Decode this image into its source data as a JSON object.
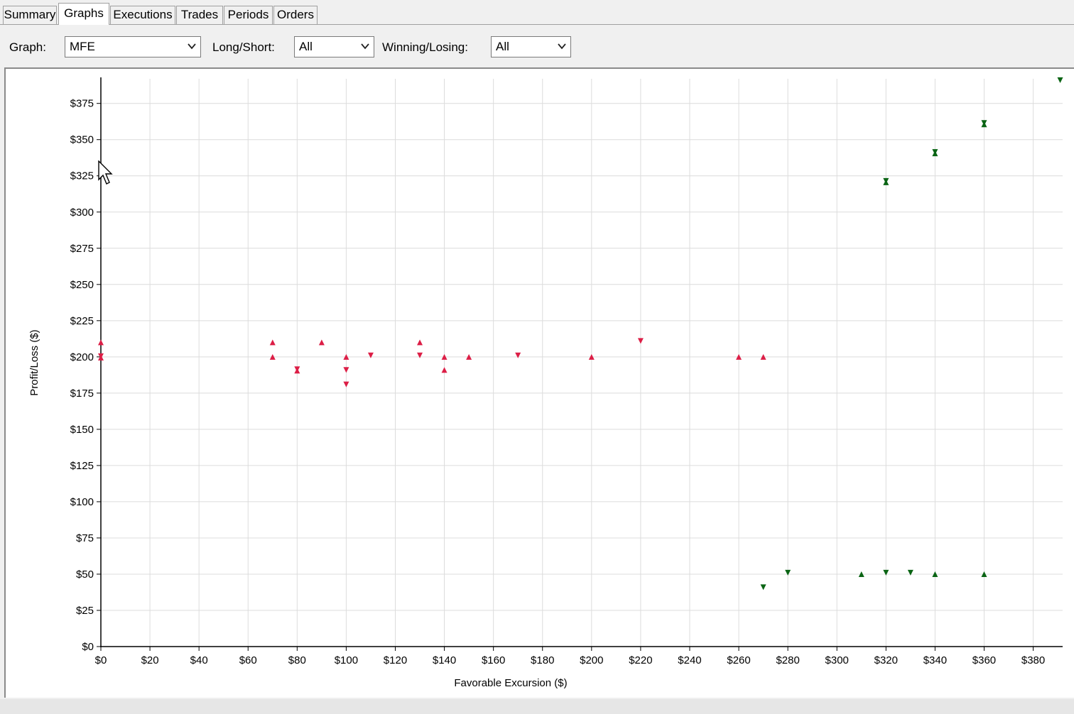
{
  "tabs": [
    {
      "label": "Summary",
      "active": false
    },
    {
      "label": "Graphs",
      "active": true
    },
    {
      "label": "Executions",
      "active": false
    },
    {
      "label": "Trades",
      "active": false
    },
    {
      "label": "Periods",
      "active": false
    },
    {
      "label": "Orders",
      "active": false
    }
  ],
  "toolbar": {
    "graph_label": "Graph:",
    "graph_value": "MFE",
    "long_short_label": "Long/Short:",
    "long_short_value": "All",
    "winning_losing_label": "Winning/Losing:",
    "winning_losing_value": "All"
  },
  "chart_data": {
    "type": "scatter",
    "xlabel": "Favorable Excursion ($)",
    "ylabel": "Profit/Loss ($)",
    "xlim": [
      0,
      392
    ],
    "ylim": [
      0,
      392
    ],
    "x_ticks": [
      0,
      20,
      40,
      60,
      80,
      100,
      120,
      140,
      160,
      180,
      200,
      220,
      240,
      260,
      280,
      300,
      320,
      340,
      360,
      380
    ],
    "y_ticks": [
      0,
      25,
      50,
      75,
      100,
      125,
      150,
      175,
      200,
      225,
      250,
      275,
      300,
      325,
      350,
      375
    ],
    "x_tick_labels": [
      "$0",
      "$20",
      "$40",
      "$60",
      "$80",
      "$100",
      "$120",
      "$140",
      "$160",
      "$180",
      "$200",
      "$220",
      "$240",
      "$260",
      "$280",
      "$300",
      "$320",
      "$340",
      "$360",
      "$380"
    ],
    "y_tick_labels": [
      "$0",
      "$25",
      "$50",
      "$75",
      "$100",
      "$125",
      "$150",
      "$175",
      "$200",
      "$225",
      "$250",
      "$275",
      "$300",
      "$325",
      "$350",
      "$375"
    ],
    "grid": true,
    "colors": {
      "red": "#dc1e46",
      "green": "#0a6414"
    },
    "points": [
      {
        "x": 0,
        "y": 210,
        "marker": "up",
        "color": "red"
      },
      {
        "x": 0,
        "y": 200,
        "marker": "both",
        "color": "red"
      },
      {
        "x": 70,
        "y": 210,
        "marker": "up",
        "color": "red"
      },
      {
        "x": 70,
        "y": 200,
        "marker": "up",
        "color": "red"
      },
      {
        "x": 80,
        "y": 191,
        "marker": "both",
        "color": "red"
      },
      {
        "x": 90,
        "y": 210,
        "marker": "up",
        "color": "red"
      },
      {
        "x": 100,
        "y": 200,
        "marker": "up",
        "color": "red"
      },
      {
        "x": 100,
        "y": 191,
        "marker": "down",
        "color": "red"
      },
      {
        "x": 100,
        "y": 181,
        "marker": "down",
        "color": "red"
      },
      {
        "x": 110,
        "y": 201,
        "marker": "down",
        "color": "red"
      },
      {
        "x": 130,
        "y": 210,
        "marker": "up",
        "color": "red"
      },
      {
        "x": 130,
        "y": 201,
        "marker": "down",
        "color": "red"
      },
      {
        "x": 140,
        "y": 200,
        "marker": "up",
        "color": "red"
      },
      {
        "x": 140,
        "y": 191,
        "marker": "up",
        "color": "red"
      },
      {
        "x": 150,
        "y": 200,
        "marker": "up",
        "color": "red"
      },
      {
        "x": 170,
        "y": 201,
        "marker": "down",
        "color": "red"
      },
      {
        "x": 200,
        "y": 200,
        "marker": "up",
        "color": "red"
      },
      {
        "x": 220,
        "y": 211,
        "marker": "down",
        "color": "red"
      },
      {
        "x": 260,
        "y": 200,
        "marker": "up",
        "color": "red"
      },
      {
        "x": 270,
        "y": 200,
        "marker": "up",
        "color": "red"
      },
      {
        "x": 270,
        "y": 41,
        "marker": "down",
        "color": "green"
      },
      {
        "x": 280,
        "y": 51,
        "marker": "down",
        "color": "green"
      },
      {
        "x": 310,
        "y": 50,
        "marker": "up",
        "color": "green"
      },
      {
        "x": 320,
        "y": 51,
        "marker": "down",
        "color": "green"
      },
      {
        "x": 320,
        "y": 321,
        "marker": "both",
        "color": "green"
      },
      {
        "x": 330,
        "y": 51,
        "marker": "down",
        "color": "green"
      },
      {
        "x": 340,
        "y": 50,
        "marker": "up",
        "color": "green"
      },
      {
        "x": 340,
        "y": 341,
        "marker": "both",
        "color": "green"
      },
      {
        "x": 360,
        "y": 50,
        "marker": "up",
        "color": "green"
      },
      {
        "x": 360,
        "y": 361,
        "marker": "both",
        "color": "green"
      },
      {
        "x": 391,
        "y": 391,
        "marker": "down",
        "color": "green"
      }
    ]
  }
}
